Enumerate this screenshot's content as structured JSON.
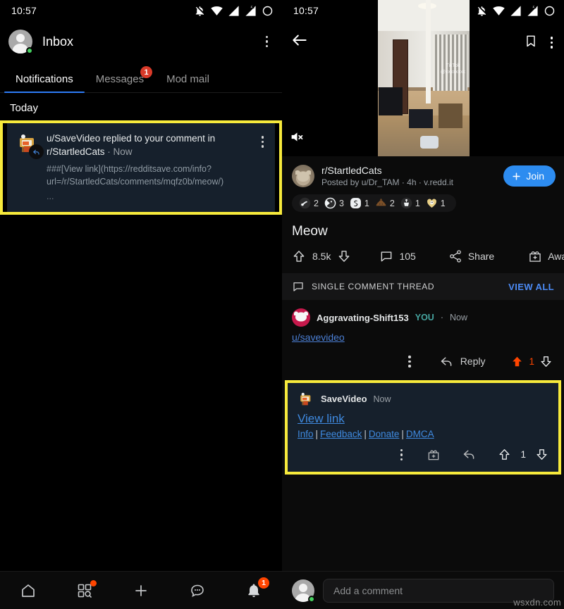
{
  "status_bar": {
    "time": "10:57",
    "icons": [
      "notifications-off-icon",
      "wifi-icon",
      "signal-icon",
      "signal-off-icon",
      "battery-icon"
    ]
  },
  "left_panel": {
    "header": {
      "title": "Inbox",
      "overflow_label": "more-options"
    },
    "tabs": [
      {
        "label": "Notifications",
        "active": true,
        "badge": ""
      },
      {
        "label": "Messages",
        "active": false,
        "badge": "1"
      },
      {
        "label": "Mod mail",
        "active": false,
        "badge": ""
      }
    ],
    "section_label": "Today",
    "notification": {
      "title": "u/SaveVideo replied to your comment in r/StartledCats",
      "separator": " · ",
      "time": "Now",
      "body": "###[View link](https://redditsave.com/info?url=/r/StartledCats/comments/mqfz0b/meow/)",
      "more": "...",
      "highlight_color": "#f7ea3c",
      "card_bg": "#16202c"
    },
    "bottom_nav": [
      {
        "name": "home-icon",
        "badge": ""
      },
      {
        "name": "discover-icon",
        "badge": "dot"
      },
      {
        "name": "create-post-icon",
        "badge": ""
      },
      {
        "name": "chat-icon",
        "badge": ""
      },
      {
        "name": "notifications-icon",
        "badge": "1"
      }
    ]
  },
  "right_panel": {
    "video": {
      "muted": true,
      "watermark": "TikTok",
      "watermark_sub": "@xxxxxxxx"
    },
    "header": {
      "back_label": "back",
      "save_label": "save",
      "overflow_label": "more-options"
    },
    "post": {
      "subreddit": "r/StartledCats",
      "posted_by": "Posted by u/Dr_TAM · 4h · v.redd.it",
      "join_label": "Join",
      "title": "Meow",
      "awards": [
        {
          "name": "award-silver-icon",
          "count": "2",
          "color": "#d9dde0"
        },
        {
          "name": "award-helpful-icon",
          "count": "3",
          "color": "#eceff1"
        },
        {
          "name": "award-snek-icon",
          "count": "1",
          "color": "#e9edef"
        },
        {
          "name": "award-poop-icon",
          "count": "2",
          "color": "#8a5a2b"
        },
        {
          "name": "award-bravo-icon",
          "count": "1",
          "color": "#e7eaec"
        },
        {
          "name": "award-wholesome-icon",
          "count": "1",
          "color": "#e8cf86"
        }
      ],
      "score": "8.5k",
      "comments": "105",
      "share_label": "Share",
      "award_label": "Award"
    },
    "thread_bar": {
      "label": "SINGLE COMMENT THREAD",
      "view_all": "VIEW ALL"
    },
    "user_comment": {
      "author": "Aggravating-Shift153",
      "you_badge": "YOU",
      "separator": "·",
      "time": "Now",
      "text": "u/savevideo",
      "reply_label": "Reply",
      "score": "1",
      "upvoted": true
    },
    "bot_reply": {
      "author": "SaveVideo",
      "time": "Now",
      "view_link": "View link",
      "links": [
        "Info",
        "Feedback",
        "Donate",
        "DMCA"
      ],
      "separator": "|",
      "score": "1",
      "highlight_color": "#f7ea3c",
      "card_bg": "#16202c"
    },
    "comment_box": {
      "placeholder": "Add a comment"
    }
  },
  "watermark": "wsxdn.com"
}
